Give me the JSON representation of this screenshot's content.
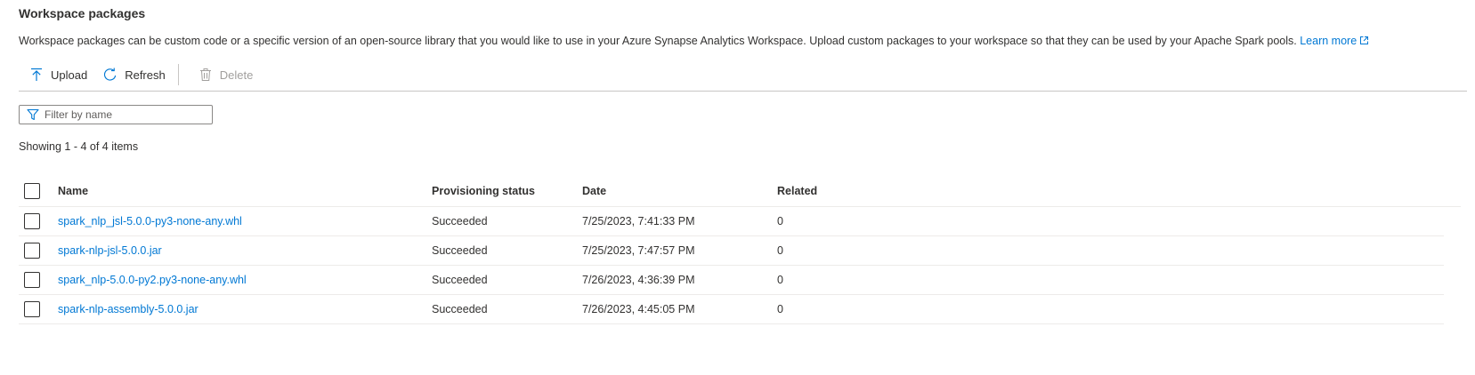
{
  "section": {
    "title": "Workspace packages",
    "description": "Workspace packages can be custom code or a specific version of an open-source library that you would like to use in your Azure Synapse Analytics Workspace. Upload custom packages to your workspace so that they can be used by your Apache Spark pools.",
    "learn_more": "Learn more"
  },
  "toolbar": {
    "upload_label": "Upload",
    "refresh_label": "Refresh",
    "delete_label": "Delete"
  },
  "filter": {
    "placeholder": "Filter by name",
    "value": ""
  },
  "showing": "Showing 1 - 4 of 4 items",
  "table": {
    "columns": {
      "name": "Name",
      "status": "Provisioning status",
      "date": "Date",
      "related": "Related"
    },
    "rows": [
      {
        "name": "spark_nlp_jsl-5.0.0-py3-none-any.whl",
        "status": "Succeeded",
        "date": "7/25/2023, 7:41:33 PM",
        "related": "0"
      },
      {
        "name": "spark-nlp-jsl-5.0.0.jar",
        "status": "Succeeded",
        "date": "7/25/2023, 7:47:57 PM",
        "related": "0"
      },
      {
        "name": "spark_nlp-5.0.0-py2.py3-none-any.whl",
        "status": "Succeeded",
        "date": "7/26/2023, 4:36:39 PM",
        "related": "0"
      },
      {
        "name": "spark-nlp-assembly-5.0.0.jar",
        "status": "Succeeded",
        "date": "7/26/2023, 4:45:05 PM",
        "related": "0"
      }
    ]
  },
  "colors": {
    "link": "#0078d4",
    "text": "#323130",
    "disabled": "#a19f9d",
    "divider": "#c8c6c4"
  },
  "icons": {
    "upload": "upload-icon",
    "refresh": "refresh-icon",
    "delete": "delete-icon",
    "filter": "filter-icon",
    "external": "external-link-icon"
  }
}
